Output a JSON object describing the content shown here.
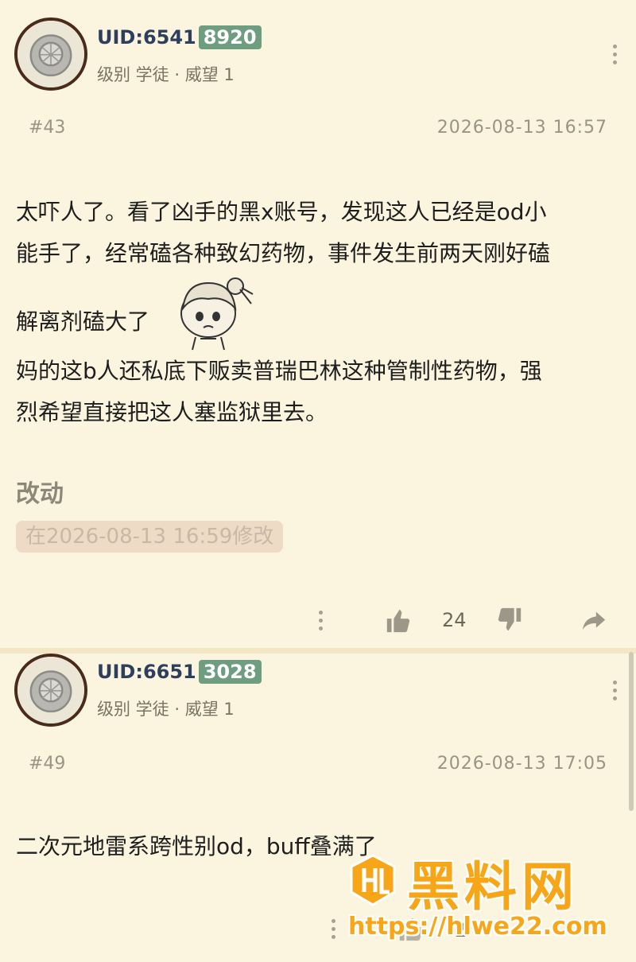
{
  "posts": [
    {
      "uid_prefix": "UID:6541",
      "uid_badge": "8920",
      "level": "级别 学徒 · 威望 1",
      "floor": "#43",
      "timestamp": "2026-08-13 16:57",
      "content": {
        "line1": "太吓人了。看了凶手的黑x账号，发现这人已经是od小",
        "line2": "能手了，经常磕各种致幻药物，事件发生前两天刚好磕",
        "line3": "解离剂磕大了",
        "line4": "妈的这b人还私底下贩卖普瑞巴林这种管制性药物，强",
        "line5": "烈希望直接把这人塞监狱里去。"
      },
      "edit_title": "改动",
      "edit_note": "在2026-08-13 16:59修改",
      "like_count": "24"
    },
    {
      "uid_prefix": "UID:6651",
      "uid_badge": "3028",
      "level": "级别 学徒 · 威望 1",
      "floor": "#49",
      "timestamp": "2026-08-13 17:05",
      "content": {
        "line1": "二次元地雷系跨性别od，buff叠满了"
      },
      "like_count": "2"
    }
  ],
  "watermark": {
    "title": "黑料网",
    "url": "https://hlwe22.com"
  },
  "colors": {
    "background": "#fbf5df",
    "uid_badge": "#6e9d80",
    "uid_text": "#2d3f5c",
    "watermark": "#f6a616"
  }
}
